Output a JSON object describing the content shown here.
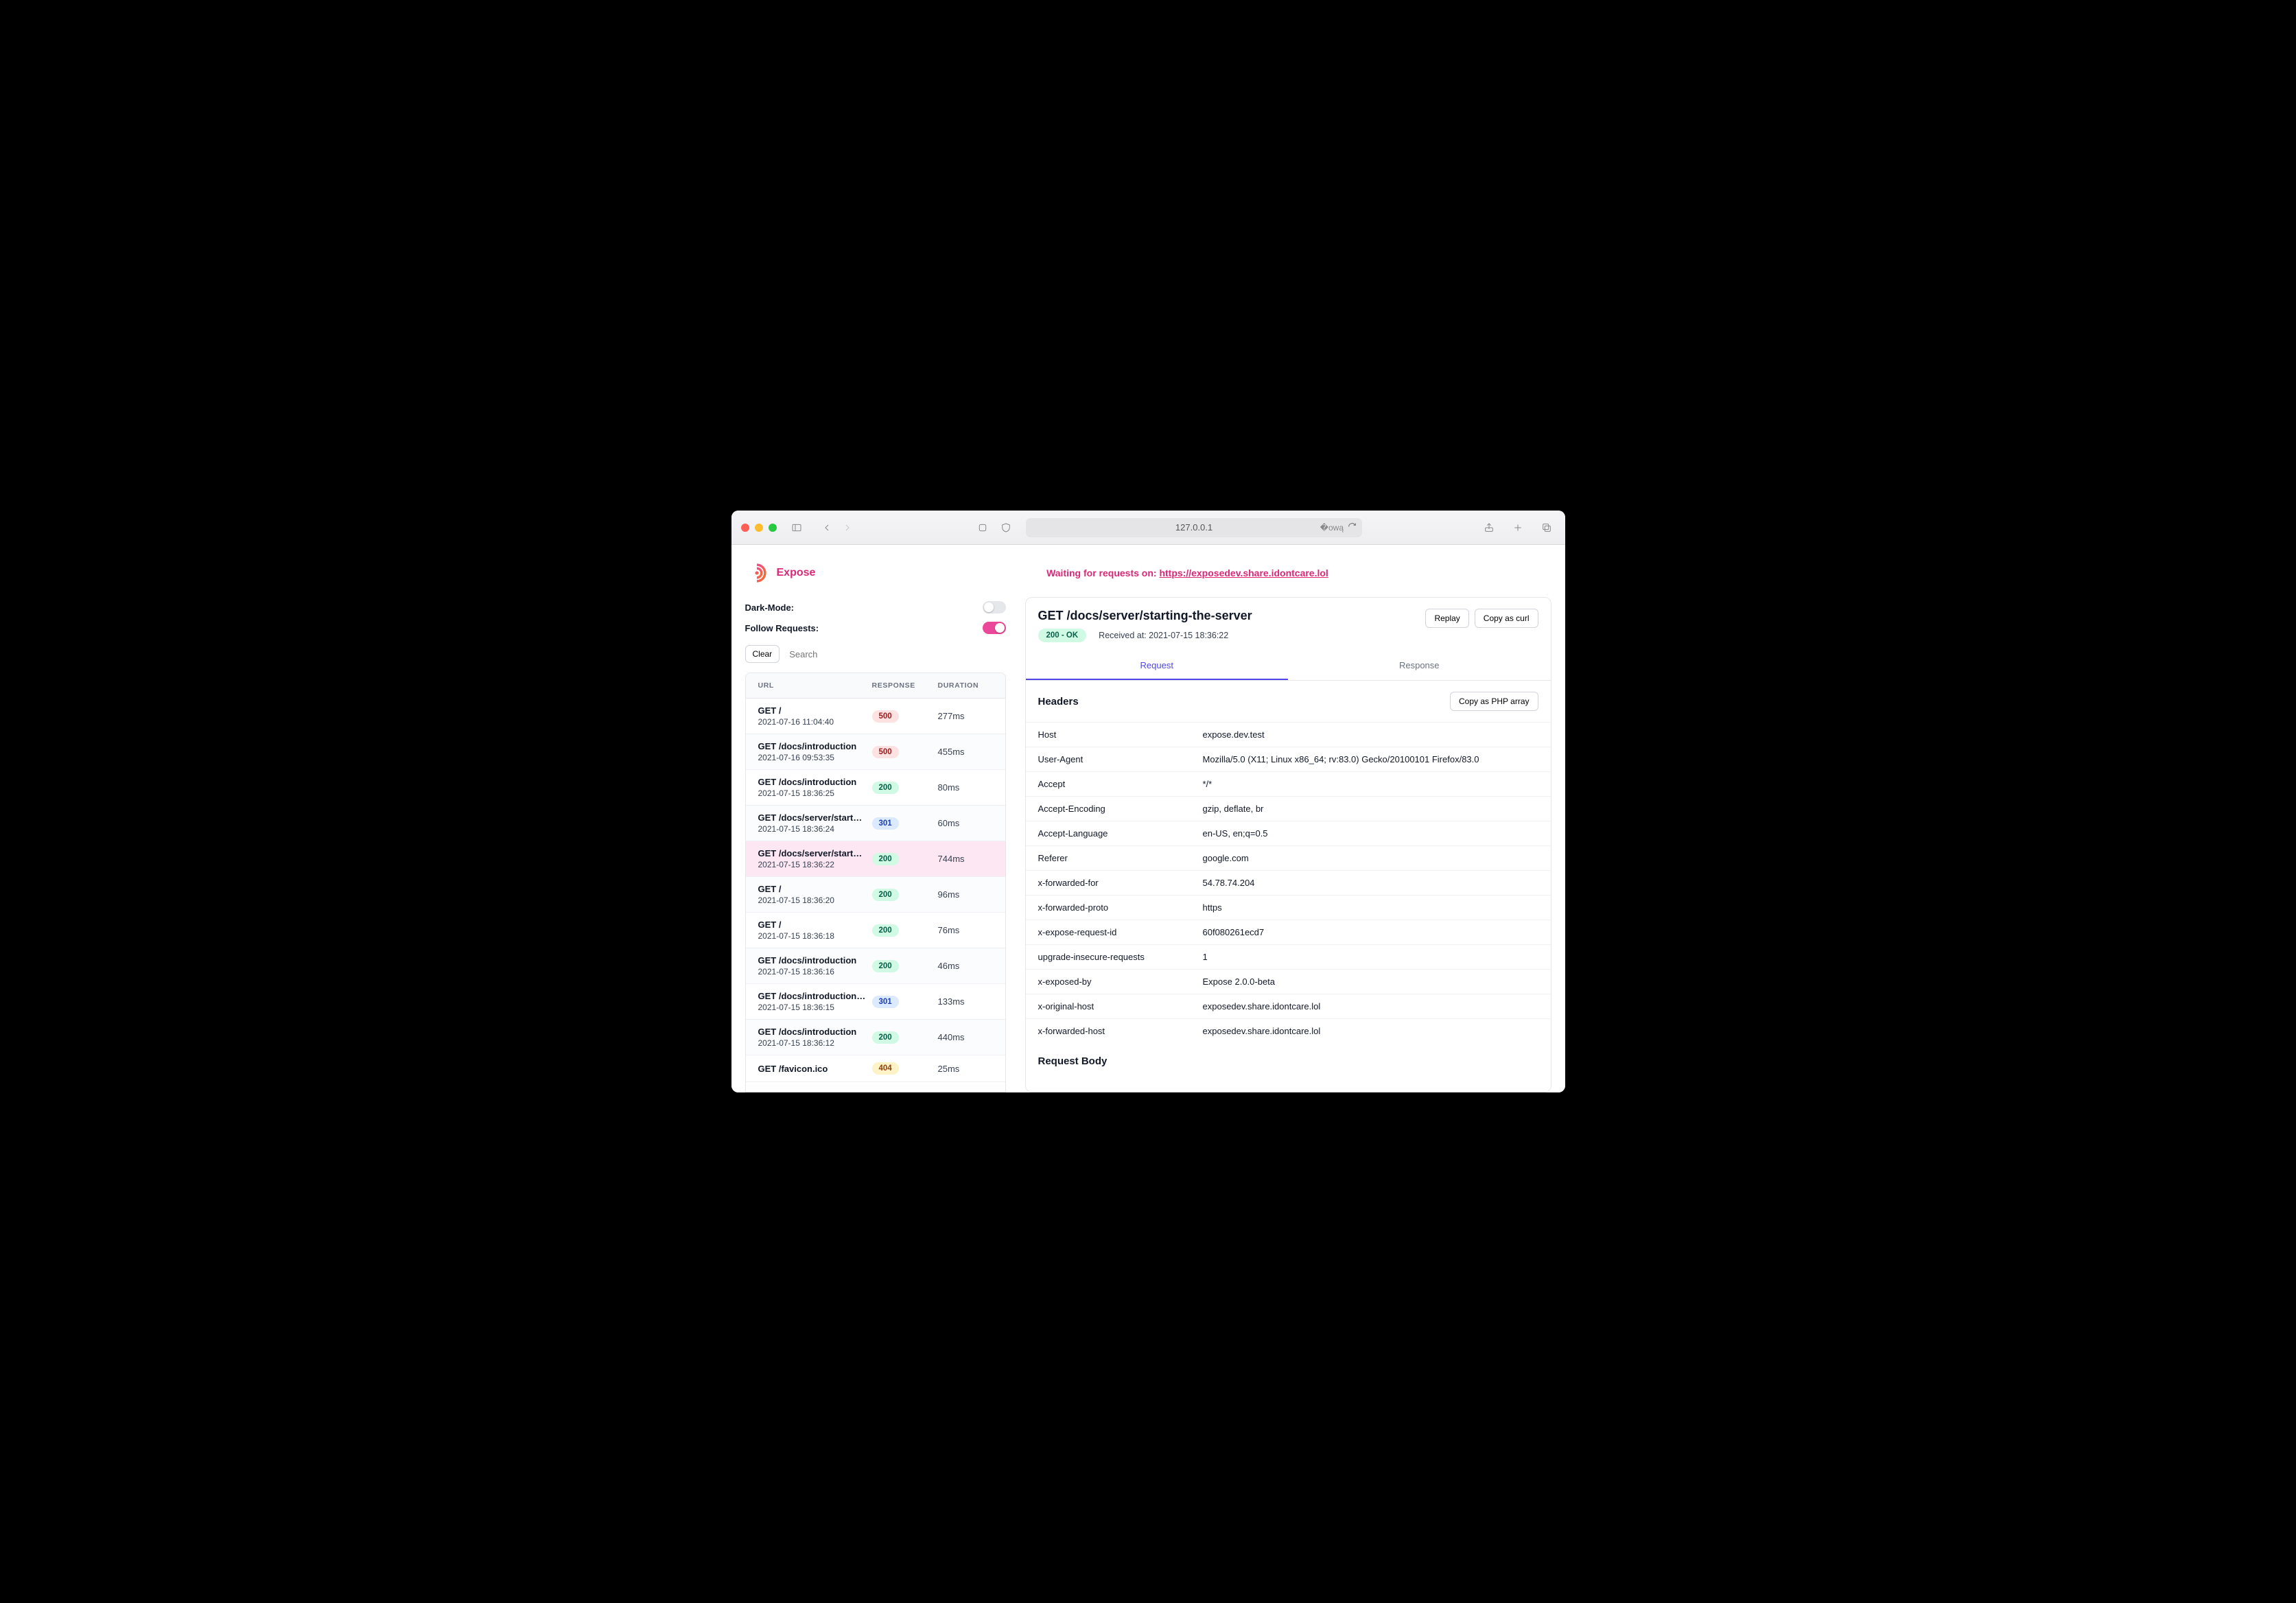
{
  "browser": {
    "address": "127.0.0.1"
  },
  "brand": "Expose",
  "waiting_label": "Waiting for requests on: ",
  "waiting_url": "https://exposedev.share.idontcare.lol",
  "settings": {
    "dark_mode_label": "Dark-Mode:",
    "dark_mode_on": false,
    "follow_label": "Follow Requests:",
    "follow_on": true,
    "clear_label": "Clear",
    "search_placeholder": "Search"
  },
  "columns": {
    "url": "URL",
    "response": "RESPONSE",
    "duration": "DURATION"
  },
  "requests": [
    {
      "path": "GET /",
      "ts": "2021-07-16 11:04:40",
      "status": 500,
      "duration": "277ms"
    },
    {
      "path": "GET /docs/introduction",
      "ts": "2021-07-16 09:53:35",
      "status": 500,
      "duration": "455ms"
    },
    {
      "path": "GET /docs/introduction",
      "ts": "2021-07-15 18:36:25",
      "status": 200,
      "duration": "80ms"
    },
    {
      "path": "GET /docs/server/start…",
      "ts": "2021-07-15 18:36:24",
      "status": 301,
      "duration": "60ms"
    },
    {
      "path": "GET /docs/server/start…",
      "ts": "2021-07-15 18:36:22",
      "status": 200,
      "duration": "744ms",
      "selected": true
    },
    {
      "path": "GET /",
      "ts": "2021-07-15 18:36:20",
      "status": 200,
      "duration": "96ms"
    },
    {
      "path": "GET /",
      "ts": "2021-07-15 18:36:18",
      "status": 200,
      "duration": "76ms"
    },
    {
      "path": "GET /docs/introduction",
      "ts": "2021-07-15 18:36:16",
      "status": 200,
      "duration": "46ms"
    },
    {
      "path": "GET /docs/introduction…",
      "ts": "2021-07-15 18:36:15",
      "status": 301,
      "duration": "133ms"
    },
    {
      "path": "GET /docs/introduction",
      "ts": "2021-07-15 18:36:12",
      "status": 200,
      "duration": "440ms"
    },
    {
      "path": "GET /favicon.ico",
      "ts": "",
      "status": 404,
      "duration": "25ms"
    }
  ],
  "detail": {
    "title": "GET /docs/server/starting-the-server",
    "status_label": "200 - OK",
    "received_label": "Received at: 2021-07-15 18:36:22",
    "replay_label": "Replay",
    "copy_curl_label": "Copy as curl",
    "tabs": {
      "request": "Request",
      "response": "Response"
    },
    "headers_section": "Headers",
    "copy_php_label": "Copy as PHP array",
    "headers": [
      {
        "k": "Host",
        "v": "expose.dev.test"
      },
      {
        "k": "User-Agent",
        "v": "Mozilla/5.0 (X11; Linux x86_64; rv:83.0) Gecko/20100101 Firefox/83.0"
      },
      {
        "k": "Accept",
        "v": "*/*"
      },
      {
        "k": "Accept-Encoding",
        "v": "gzip, deflate, br"
      },
      {
        "k": "Accept-Language",
        "v": "en-US, en;q=0.5"
      },
      {
        "k": "Referer",
        "v": "google.com"
      },
      {
        "k": "x-forwarded-for",
        "v": "54.78.74.204"
      },
      {
        "k": "x-forwarded-proto",
        "v": "https"
      },
      {
        "k": "x-expose-request-id",
        "v": "60f080261ecd7"
      },
      {
        "k": "upgrade-insecure-requests",
        "v": "1"
      },
      {
        "k": "x-exposed-by",
        "v": "Expose 2.0.0-beta"
      },
      {
        "k": "x-original-host",
        "v": "exposedev.share.idontcare.lol"
      },
      {
        "k": "x-forwarded-host",
        "v": "exposedev.share.idontcare.lol"
      }
    ],
    "body_section": "Request Body"
  }
}
